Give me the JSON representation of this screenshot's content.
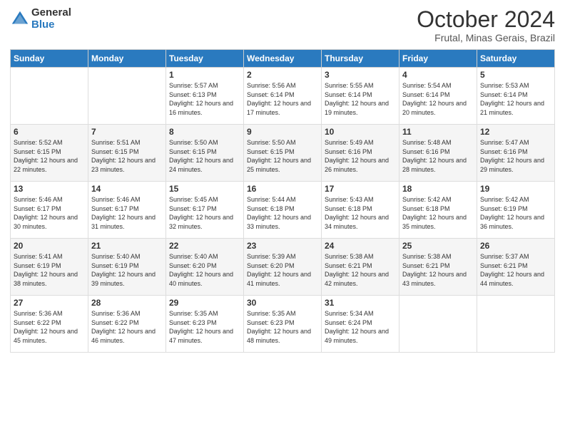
{
  "logo": {
    "general": "General",
    "blue": "Blue"
  },
  "header": {
    "month": "October 2024",
    "location": "Frutal, Minas Gerais, Brazil"
  },
  "days_of_week": [
    "Sunday",
    "Monday",
    "Tuesday",
    "Wednesday",
    "Thursday",
    "Friday",
    "Saturday"
  ],
  "weeks": [
    [
      {
        "day": "",
        "info": ""
      },
      {
        "day": "",
        "info": ""
      },
      {
        "day": "1",
        "info": "Sunrise: 5:57 AM\nSunset: 6:13 PM\nDaylight: 12 hours and 16 minutes."
      },
      {
        "day": "2",
        "info": "Sunrise: 5:56 AM\nSunset: 6:14 PM\nDaylight: 12 hours and 17 minutes."
      },
      {
        "day": "3",
        "info": "Sunrise: 5:55 AM\nSunset: 6:14 PM\nDaylight: 12 hours and 19 minutes."
      },
      {
        "day": "4",
        "info": "Sunrise: 5:54 AM\nSunset: 6:14 PM\nDaylight: 12 hours and 20 minutes."
      },
      {
        "day": "5",
        "info": "Sunrise: 5:53 AM\nSunset: 6:14 PM\nDaylight: 12 hours and 21 minutes."
      }
    ],
    [
      {
        "day": "6",
        "info": "Sunrise: 5:52 AM\nSunset: 6:15 PM\nDaylight: 12 hours and 22 minutes."
      },
      {
        "day": "7",
        "info": "Sunrise: 5:51 AM\nSunset: 6:15 PM\nDaylight: 12 hours and 23 minutes."
      },
      {
        "day": "8",
        "info": "Sunrise: 5:50 AM\nSunset: 6:15 PM\nDaylight: 12 hours and 24 minutes."
      },
      {
        "day": "9",
        "info": "Sunrise: 5:50 AM\nSunset: 6:15 PM\nDaylight: 12 hours and 25 minutes."
      },
      {
        "day": "10",
        "info": "Sunrise: 5:49 AM\nSunset: 6:16 PM\nDaylight: 12 hours and 26 minutes."
      },
      {
        "day": "11",
        "info": "Sunrise: 5:48 AM\nSunset: 6:16 PM\nDaylight: 12 hours and 28 minutes."
      },
      {
        "day": "12",
        "info": "Sunrise: 5:47 AM\nSunset: 6:16 PM\nDaylight: 12 hours and 29 minutes."
      }
    ],
    [
      {
        "day": "13",
        "info": "Sunrise: 5:46 AM\nSunset: 6:17 PM\nDaylight: 12 hours and 30 minutes."
      },
      {
        "day": "14",
        "info": "Sunrise: 5:46 AM\nSunset: 6:17 PM\nDaylight: 12 hours and 31 minutes."
      },
      {
        "day": "15",
        "info": "Sunrise: 5:45 AM\nSunset: 6:17 PM\nDaylight: 12 hours and 32 minutes."
      },
      {
        "day": "16",
        "info": "Sunrise: 5:44 AM\nSunset: 6:18 PM\nDaylight: 12 hours and 33 minutes."
      },
      {
        "day": "17",
        "info": "Sunrise: 5:43 AM\nSunset: 6:18 PM\nDaylight: 12 hours and 34 minutes."
      },
      {
        "day": "18",
        "info": "Sunrise: 5:42 AM\nSunset: 6:18 PM\nDaylight: 12 hours and 35 minutes."
      },
      {
        "day": "19",
        "info": "Sunrise: 5:42 AM\nSunset: 6:19 PM\nDaylight: 12 hours and 36 minutes."
      }
    ],
    [
      {
        "day": "20",
        "info": "Sunrise: 5:41 AM\nSunset: 6:19 PM\nDaylight: 12 hours and 38 minutes."
      },
      {
        "day": "21",
        "info": "Sunrise: 5:40 AM\nSunset: 6:19 PM\nDaylight: 12 hours and 39 minutes."
      },
      {
        "day": "22",
        "info": "Sunrise: 5:40 AM\nSunset: 6:20 PM\nDaylight: 12 hours and 40 minutes."
      },
      {
        "day": "23",
        "info": "Sunrise: 5:39 AM\nSunset: 6:20 PM\nDaylight: 12 hours and 41 minutes."
      },
      {
        "day": "24",
        "info": "Sunrise: 5:38 AM\nSunset: 6:21 PM\nDaylight: 12 hours and 42 minutes."
      },
      {
        "day": "25",
        "info": "Sunrise: 5:38 AM\nSunset: 6:21 PM\nDaylight: 12 hours and 43 minutes."
      },
      {
        "day": "26",
        "info": "Sunrise: 5:37 AM\nSunset: 6:21 PM\nDaylight: 12 hours and 44 minutes."
      }
    ],
    [
      {
        "day": "27",
        "info": "Sunrise: 5:36 AM\nSunset: 6:22 PM\nDaylight: 12 hours and 45 minutes."
      },
      {
        "day": "28",
        "info": "Sunrise: 5:36 AM\nSunset: 6:22 PM\nDaylight: 12 hours and 46 minutes."
      },
      {
        "day": "29",
        "info": "Sunrise: 5:35 AM\nSunset: 6:23 PM\nDaylight: 12 hours and 47 minutes."
      },
      {
        "day": "30",
        "info": "Sunrise: 5:35 AM\nSunset: 6:23 PM\nDaylight: 12 hours and 48 minutes."
      },
      {
        "day": "31",
        "info": "Sunrise: 5:34 AM\nSunset: 6:24 PM\nDaylight: 12 hours and 49 minutes."
      },
      {
        "day": "",
        "info": ""
      },
      {
        "day": "",
        "info": ""
      }
    ]
  ]
}
